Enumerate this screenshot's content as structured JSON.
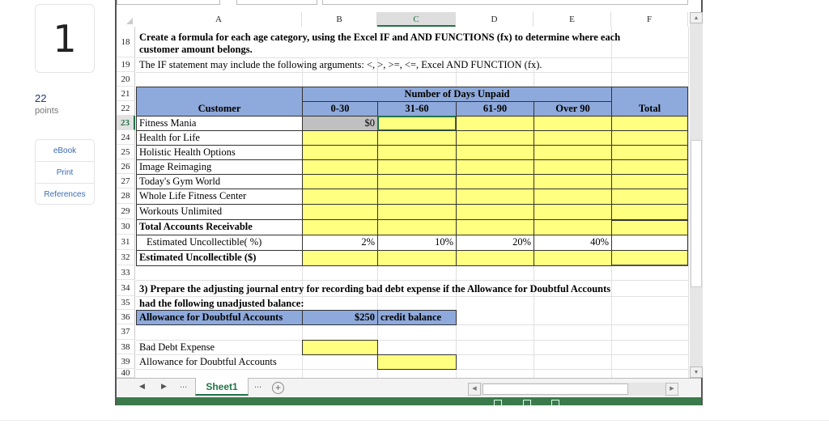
{
  "question": {
    "number": "1",
    "points_value": "22",
    "points_label": "points",
    "tools": [
      "eBook",
      "Print",
      "References"
    ]
  },
  "spreadsheet": {
    "columns": [
      "A",
      "B",
      "C",
      "D",
      "E",
      "F"
    ],
    "selected_column": "C",
    "selected_row": "23",
    "rows": {
      "r18": {
        "num": "18",
        "line1": "Create a formula for each age category, using the Excel IF and AND FUNCTIONS (fx) to determine where each",
        "line2": "customer amount belongs."
      },
      "r19": {
        "num": "19",
        "text": "The IF statement may include the following arguments:  <, >, >=, <=, Excel AND FUNCTION (fx)."
      },
      "r20": {
        "num": "20"
      },
      "r21": {
        "num": "21"
      },
      "r22": {
        "num": "22"
      },
      "r33": {
        "num": "33"
      },
      "r34": {
        "num": "34",
        "text": "3) Prepare the adjusting journal entry for recording bad debt expense if the Allowance for Doubtful Accounts"
      },
      "r35": {
        "num": "35",
        "text": "had the following unadjusted balance:"
      },
      "r36": {
        "num": "36",
        "label": "Allowance for Doubtful Accounts",
        "amount": "$250",
        "note": "credit balance"
      },
      "r37": {
        "num": "37"
      },
      "r38": {
        "num": "38",
        "label": "Bad Debt Expense"
      },
      "r39": {
        "num": "39",
        "label": "Allowance for Doubtful Accounts"
      },
      "r40": {
        "num": "40"
      }
    },
    "aging_table": {
      "group_header": "Number of Days Unpaid",
      "customer_header": "Customer",
      "headers": [
        "0-30",
        "31-60",
        "61-90",
        "Over 90",
        "Total"
      ],
      "customers": [
        {
          "num": "23",
          "name": "Fitness Mania",
          "b": "$0"
        },
        {
          "num": "24",
          "name": "Health for Life"
        },
        {
          "num": "25",
          "name": "Holistic Health Options"
        },
        {
          "num": "26",
          "name": "Image Reimaging"
        },
        {
          "num": "27",
          "name": "Today's Gym World"
        },
        {
          "num": "28",
          "name": "Whole Life Fitness Center"
        },
        {
          "num": "29",
          "name": "Workouts Unlimited"
        }
      ],
      "total_row": {
        "num": "30",
        "label": "Total Accounts Receivable"
      },
      "pct_row": {
        "num": "31",
        "label": "Estimated Uncollectible( %)",
        "values": [
          "2%",
          "10%",
          "20%",
          "40%",
          ""
        ]
      },
      "est_row": {
        "num": "32",
        "label": "Estimated Uncollectible ($)"
      }
    },
    "sheet_tabs": [
      "Sheet1"
    ],
    "tab_ellipsis": "...",
    "colors": {
      "yellow": "#ffff80",
      "header_blue": "#8ea9db",
      "excel_green": "#217346",
      "status_green": "#3b7a4b",
      "selected_gray": "#c0c0c0"
    }
  }
}
